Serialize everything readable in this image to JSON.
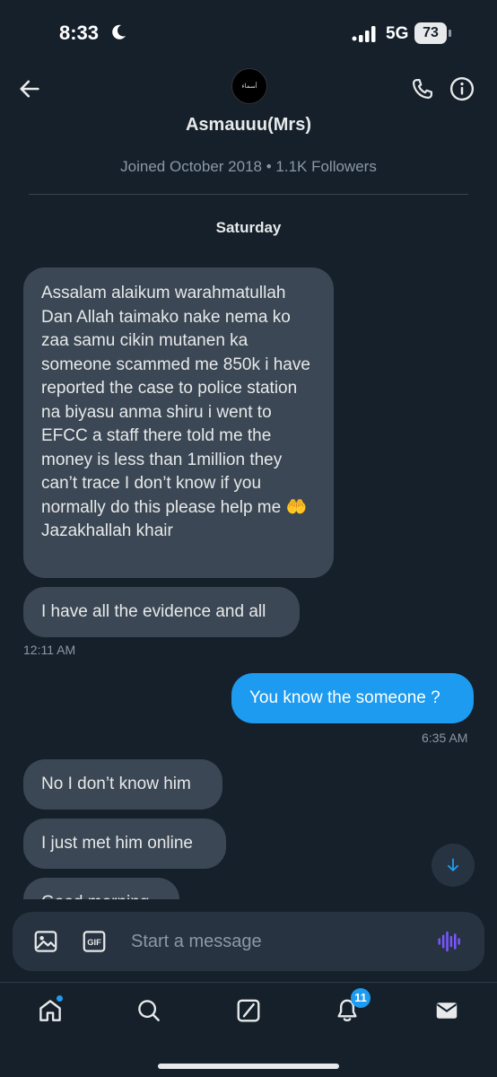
{
  "status_bar": {
    "time": "8:33",
    "network": "5G",
    "battery": "73"
  },
  "header": {
    "avatar_text": "أسماء",
    "name": "Asmauuu(Mrs)",
    "meta": "Joined October 2018 • 1.1K Followers"
  },
  "conversation": {
    "day_label": "Saturday",
    "messages": [
      {
        "direction": "in",
        "text": "Assalam alaikum warahmatullah Dan Allah taimako nake nema ko zaa samu cikin mutanen ka someone scammed me 850k i have reported the case to police station na biyasu anma shiru i went to EFCC a staff there told me the money is less than 1million they can’t trace I don’t know if you normally do this please help me 🤲Jazakhallah khair"
      },
      {
        "direction": "in",
        "text": "I have all the evidence and all",
        "timestamp": "12:11 AM"
      },
      {
        "direction": "out",
        "text": "You know the someone ?",
        "timestamp": "6:35 AM"
      },
      {
        "direction": "in",
        "text": "No I don’t know him"
      },
      {
        "direction": "in",
        "text": "I just met him online"
      },
      {
        "direction": "in",
        "text": "Good morning"
      }
    ]
  },
  "composer": {
    "placeholder": "Start a message"
  },
  "nav": {
    "notification_count": "11"
  },
  "colors": {
    "background": "#15202b",
    "incoming_bubble": "#3b4754",
    "outgoing_bubble": "#1d9bf0",
    "accent": "#1d9bf0",
    "voice_icon": "#7856ff"
  },
  "icons": [
    "back-arrow-icon",
    "phone-icon",
    "info-icon",
    "image-icon",
    "gif-icon",
    "voice-icon",
    "arrow-down-icon",
    "home-icon",
    "search-icon",
    "grok-icon",
    "bell-icon",
    "mail-icon"
  ]
}
